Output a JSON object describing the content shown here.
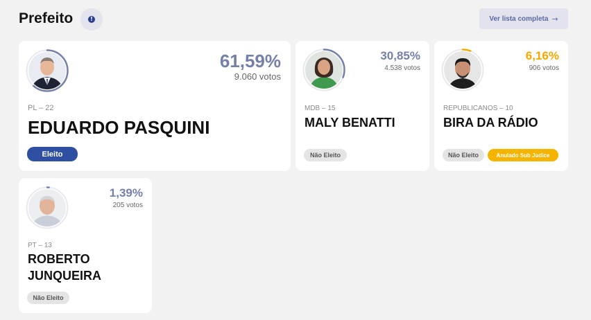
{
  "header": {
    "title": "Prefeito",
    "info_icon": "info-icon",
    "list_button_label": "Ver lista completa",
    "list_button_icon": "arrow-right-icon"
  },
  "colors": {
    "accent": "#2f4fa2",
    "percent_main": "#7480a8",
    "percent_yellow": "#f5a800",
    "elected_badge": "#2f4fa2",
    "sub_judice_badge": "#f5b400"
  },
  "candidates": [
    {
      "party": "PL – 22",
      "name": "EDUARDO PASQUINI",
      "percent": "61,59%",
      "votes": "9.060 votos",
      "share": 0.6159,
      "status": "Eleito"
    },
    {
      "party": "MDB – 15",
      "name": "MALY BENATTI",
      "percent": "30,85%",
      "votes": "4.538 votos",
      "share": 0.3085,
      "status": "Não Eleito"
    },
    {
      "party": "REPUBLICANOS – 10",
      "name": "BIRA DA RÁDIO",
      "percent": "6,16%",
      "votes": "906 votos",
      "share": 0.0616,
      "status": "Não Eleito",
      "extra_status": "Anulado Sub Judice"
    },
    {
      "party": "PT – 13",
      "name_line1": "ROBERTO",
      "name_line2": "JUNQUEIRA",
      "percent": "1,39%",
      "votes": "205 votos",
      "share": 0.0139,
      "status": "Não Eleito"
    }
  ]
}
